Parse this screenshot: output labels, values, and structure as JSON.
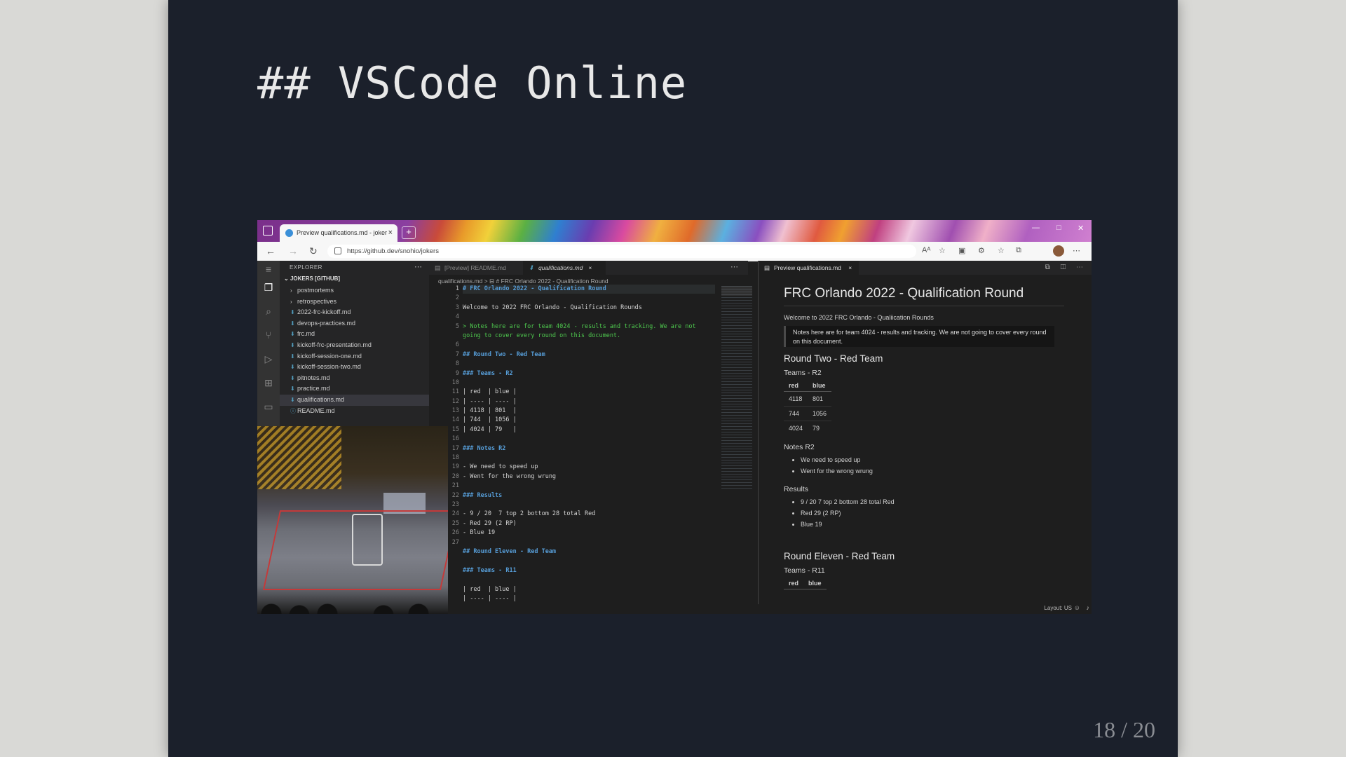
{
  "slide": {
    "title": "## VSCode Online",
    "page_number": "18 / 20"
  },
  "browser": {
    "tab_title": "Preview qualifications.md - joker",
    "tab_close": "×",
    "new_tab": "+",
    "url": "https://github.dev/snohio/jokers",
    "nav": {
      "back": "←",
      "forward": "→",
      "refresh": "↻"
    },
    "window_controls": {
      "minimize": "—",
      "maximize": "□",
      "close": "✕"
    },
    "toolbar_icons": [
      "Aᴬ",
      "☆",
      "▣",
      "⚙",
      "☆",
      "⧉",
      "⋯"
    ]
  },
  "vscode": {
    "activity_icons": [
      "menu-icon",
      "explorer-icon",
      "search-icon",
      "source-control-icon",
      "run-debug-icon",
      "extensions-icon",
      "remote-explorer-icon"
    ],
    "explorer": {
      "header": "EXPLORER",
      "dots": "⋯",
      "root": "JOKERS [GITHUB]",
      "items": [
        {
          "label": "postmortems",
          "type": "folder"
        },
        {
          "label": "retrospectives",
          "type": "folder"
        },
        {
          "label": "2022-frc-kickoff.md",
          "type": "md"
        },
        {
          "label": "devops-practices.md",
          "type": "md"
        },
        {
          "label": "frc.md",
          "type": "md"
        },
        {
          "label": "kickoff-frc-presentation.md",
          "type": "md"
        },
        {
          "label": "kickoff-session-one.md",
          "type": "md"
        },
        {
          "label": "kickoff-session-two.md",
          "type": "md"
        },
        {
          "label": "pitnotes.md",
          "type": "md"
        },
        {
          "label": "practice.md",
          "type": "md"
        },
        {
          "label": "qualifications.md",
          "type": "md",
          "selected": true
        },
        {
          "label": "README.md",
          "type": "info"
        }
      ]
    },
    "editor_tabs": [
      {
        "label": "[Preview] README.md",
        "active": false
      },
      {
        "label": "qualifications.md",
        "active": true,
        "close": "×"
      }
    ],
    "editor_dots": "⋯",
    "breadcrumb": "qualifications.md > ⊟ # FRC Orlando 2022 - Qualification Round",
    "line_numbers": [
      "1",
      "2",
      "3",
      "4",
      "5",
      "",
      "6",
      "7",
      "8",
      "9",
      "10",
      "11",
      "12",
      "13",
      "14",
      "15",
      "16",
      "17",
      "18",
      "19",
      "20",
      "21",
      "22",
      "23",
      "24",
      "25",
      "26",
      "27"
    ],
    "code_lines": [
      {
        "text": "# FRC Orlando 2022 - Qualification Round",
        "kind": "head"
      },
      {
        "text": "",
        "kind": "plain"
      },
      {
        "text": "Welcome to 2022 FRC Orlando - Qualification Rounds",
        "kind": "plain"
      },
      {
        "text": "",
        "kind": "plain"
      },
      {
        "text": "> Notes here are for team 4024 - results and tracking. We are not",
        "kind": "quote"
      },
      {
        "text": "going to cover every round on this document.",
        "kind": "quote"
      },
      {
        "text": "",
        "kind": "plain"
      },
      {
        "text": "## Round Two - Red Team",
        "kind": "head"
      },
      {
        "text": "",
        "kind": "plain"
      },
      {
        "text": "### Teams - R2",
        "kind": "head"
      },
      {
        "text": "",
        "kind": "plain"
      },
      {
        "text": "| red  | blue |",
        "kind": "plain"
      },
      {
        "text": "| ---- | ---- |",
        "kind": "plain"
      },
      {
        "text": "| 4118 | 801  |",
        "kind": "plain"
      },
      {
        "text": "| 744  | 1056 |",
        "kind": "plain"
      },
      {
        "text": "| 4024 | 79   |",
        "kind": "plain"
      },
      {
        "text": "",
        "kind": "plain"
      },
      {
        "text": "### Notes R2",
        "kind": "head"
      },
      {
        "text": "",
        "kind": "plain"
      },
      {
        "text": "- We need to speed up",
        "kind": "plain"
      },
      {
        "text": "- Went for the wrong wrung",
        "kind": "plain"
      },
      {
        "text": "",
        "kind": "plain"
      },
      {
        "text": "### Results",
        "kind": "head"
      },
      {
        "text": "",
        "kind": "plain"
      },
      {
        "text": "- 9 / 20  7 top 2 bottom 28 total Red",
        "kind": "plain"
      },
      {
        "text": "- Red 29 (2 RP)",
        "kind": "plain"
      },
      {
        "text": "- Blue 19",
        "kind": "plain"
      },
      {
        "text": "",
        "kind": "plain"
      },
      {
        "text": "## Round Eleven - Red Team",
        "kind": "head"
      },
      {
        "text": "",
        "kind": "plain"
      },
      {
        "text": "### Teams - R11",
        "kind": "head"
      },
      {
        "text": "",
        "kind": "plain"
      },
      {
        "text": "| red  | blue |",
        "kind": "plain"
      },
      {
        "text": "| ---- | ---- |",
        "kind": "plain"
      }
    ],
    "preview_tab": {
      "label": "Preview qualifications.md",
      "close": "×",
      "actions": "⧉ ◫ ⋯"
    },
    "preview": {
      "h1": "FRC Orlando 2022 - Qualification Round",
      "welcome": "Welcome to 2022 FRC Orlando - Qualiication Rounds",
      "quote": "Notes here are for team 4024 - results and tracking. We are not going to cover every round on this document.",
      "r2_heading": "Round Two - Red Team",
      "r2_teams": "Teams - R2",
      "table_headers": [
        "red",
        "blue"
      ],
      "r2_rows": [
        [
          "4118",
          "801"
        ],
        [
          "744",
          "1056"
        ],
        [
          "4024",
          "79"
        ]
      ],
      "notes_heading": "Notes R2",
      "notes": [
        "We need to speed up",
        "Went for the wrong wrung"
      ],
      "results_heading": "Results",
      "results": [
        "9 / 20 7 top 2 bottom 28 total Red",
        "Red 29 (2 RP)",
        "Blue 19"
      ],
      "r11_heading": "Round Eleven - Red Team",
      "r11_teams": "Teams - R11"
    },
    "status": {
      "layout": "Layout: US"
    }
  }
}
